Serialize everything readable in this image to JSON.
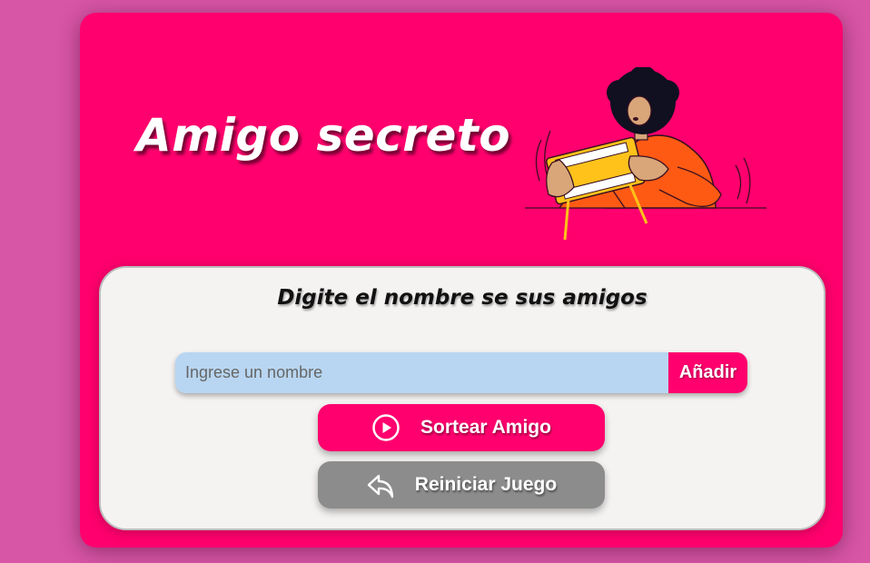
{
  "header": {
    "title": "Amigo secreto",
    "illustration": "person-playing-handheld-game"
  },
  "input_section": {
    "title": "Digite el nombre se sus amigos",
    "name_input": {
      "placeholder": "Ingrese un nombre",
      "value": ""
    },
    "add_button_label": "Añadir",
    "draw_button": {
      "label": "Sortear Amigo",
      "icon": "play-circle-icon"
    },
    "reset_button": {
      "label": "Reiniciar Juego",
      "icon": "reply-arrow-icon"
    }
  },
  "colors": {
    "page_background": "#d856a6",
    "accent": "#ff006e",
    "input_background": "#b8d6f1",
    "card_background": "#f5f3f2",
    "reset_button": "#8c8c8c"
  }
}
